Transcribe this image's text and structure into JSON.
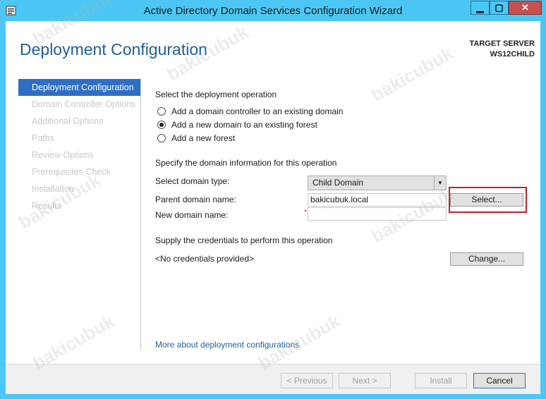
{
  "window": {
    "title": "Active Directory Domain Services Configuration Wizard",
    "controls": {
      "minimize": "▁",
      "maximize": "▢",
      "close": "✕"
    }
  },
  "header": {
    "page_title": "Deployment Configuration",
    "target_label": "TARGET SERVER",
    "target_name": "WS12CHILD"
  },
  "nav": {
    "items": [
      {
        "label": "Deployment Configuration",
        "active": true
      },
      {
        "label": "Domain Controller Options",
        "active": false
      },
      {
        "label": "Additional Options",
        "active": false
      },
      {
        "label": "Paths",
        "active": false
      },
      {
        "label": "Review Options",
        "active": false
      },
      {
        "label": "Prerequisites Check",
        "active": false
      },
      {
        "label": "Installation",
        "active": false
      },
      {
        "label": "Results",
        "active": false
      }
    ]
  },
  "deployment": {
    "heading": "Select the deployment operation",
    "options": [
      {
        "label": "Add a domain controller to an existing domain",
        "checked": false
      },
      {
        "label": "Add a new domain to an existing forest",
        "checked": true
      },
      {
        "label": "Add a new forest",
        "checked": false
      }
    ]
  },
  "domain_info": {
    "heading": "Specify the domain information for this operation",
    "domain_type_label": "Select domain type:",
    "domain_type_value": "Child Domain",
    "parent_label": "Parent domain name:",
    "parent_value": "bakicubuk.local",
    "new_label": "New domain name:",
    "new_value": "",
    "required_mark": "*",
    "select_button": "Select..."
  },
  "credentials": {
    "heading": "Supply the credentials to perform this operation",
    "status": "<No credentials provided>",
    "change_button": "Change..."
  },
  "more_link": "More about deployment configurations",
  "footer": {
    "previous": "< Previous",
    "next": "Next >",
    "install": "Install",
    "cancel": "Cancel"
  },
  "watermark": "bakicubuk",
  "colors": {
    "titlebar": "#4cc7f5",
    "accent": "#2e6fc5",
    "title_blue": "#1e5f97",
    "highlight": "#c0202a"
  }
}
